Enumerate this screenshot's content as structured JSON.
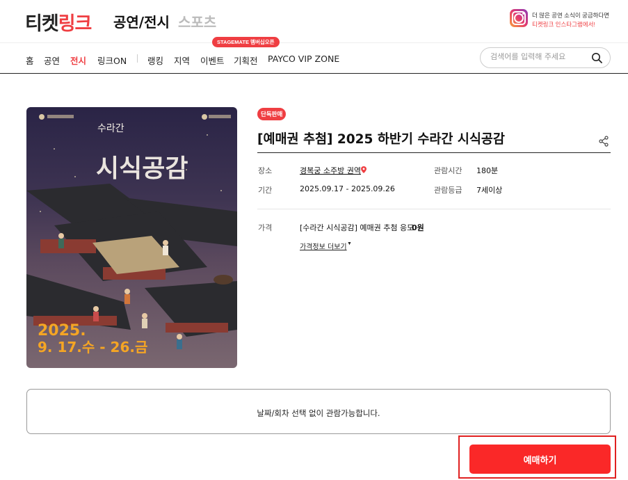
{
  "header": {
    "logo_main": "티켓",
    "logo_accent": "링크",
    "tabs": [
      {
        "label": "공연/전시",
        "active": true
      },
      {
        "label": "스포츠",
        "active": false
      }
    ],
    "instagram": {
      "line1": "더 많은 공연 소식이 궁금하다면",
      "line2": "티켓링크 인스타그램에서!",
      "icon": "instagram-icon"
    }
  },
  "nav": {
    "items": [
      "홈",
      "공연",
      "전시",
      "링크ON",
      "랭킹",
      "지역",
      "이벤트",
      "기획전",
      "PAYCO VIP ZONE"
    ],
    "active": "전시",
    "event_badge": "STAGEMATE 멤버십오픈",
    "search_placeholder": "검색어를 입력해 주세요"
  },
  "product": {
    "badge": "단독판매",
    "title": "[예매권 추첨] 2025 하반기 수라간 시식공감",
    "venue_label": "장소",
    "venue": "경복궁 소주방 권역",
    "period_label": "기간",
    "period": "2025.09.17 - 2025.09.26",
    "runtime_label": "관람시간",
    "runtime": "180분",
    "rating_label": "관람등급",
    "rating": "7세이상",
    "price_label": "가격",
    "price_name": "[수라간 시식공감] 예매권 추첨 응모",
    "price_value": "0원",
    "more_price": "가격정보 더보기",
    "poster": {
      "title_small": "수라간",
      "title_big": "시식공감",
      "date_line1": "2025.",
      "date_line2": "9. 17.수 - 26.금"
    }
  },
  "notice": "날짜/회차 선택 없이 관람가능합니다.",
  "reserve_button": "예매하기",
  "colors": {
    "accent": "#ef3e42",
    "button": "#fa2828"
  }
}
